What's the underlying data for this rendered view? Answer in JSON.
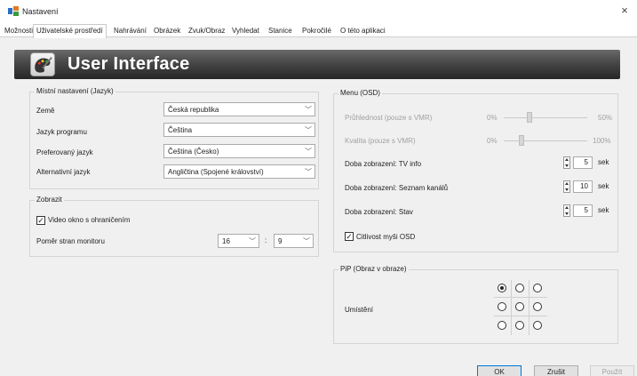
{
  "window": {
    "title": "Nastavení",
    "close": "×"
  },
  "tabs": [
    {
      "label": "Možnosti"
    },
    {
      "label": "Uživatelské prostředí",
      "active": true
    },
    {
      "label": "Nahrávání"
    },
    {
      "label": "Obrázek"
    },
    {
      "label": "Zvuk/Obraz"
    },
    {
      "label": "Vyhledat"
    },
    {
      "label": "Stanice"
    },
    {
      "label": "Pokročilé"
    },
    {
      "label": "O této aplikaci"
    }
  ],
  "banner": {
    "title": "User Interface",
    "icon": "palette-icon"
  },
  "local": {
    "title": "Místní nastavení (Jazyk)",
    "country": {
      "label": "Země",
      "value": "Česká republika"
    },
    "program_language": {
      "label": "Jazyk programu",
      "value": "Čeština"
    },
    "preferred_language": {
      "label": "Preferovaný jazyk",
      "value": "Čeština (Česko)"
    },
    "alt_language": {
      "label": "Alternativní jazyk",
      "value": "Angličtina (Spojené království)"
    }
  },
  "display": {
    "title": "Zobrazit",
    "video_border": {
      "label": "Video okno s ohraničením",
      "checked": true
    },
    "aspect": {
      "label": "Poměr stran monitoru",
      "width": "16",
      "separator": ":",
      "height": "9"
    }
  },
  "menu": {
    "title": "Menu (OSD)",
    "transparency": {
      "label": "Průhlednost (pouze s VMR)",
      "min": "0%",
      "max": "50%",
      "level": 0.4
    },
    "quality": {
      "label": "Kvalita (pouze s VMR)",
      "min": "0%",
      "max": "100%",
      "level": 0.2
    },
    "tv_info": {
      "label": "Doba zobrazení: TV info",
      "value": "5",
      "unit": "sek"
    },
    "channel_list": {
      "label": "Doba zobrazení: Seznam kanálů",
      "value": "10",
      "unit": "sek"
    },
    "status": {
      "label": "Doba zobrazení: Stav",
      "value": "5",
      "unit": "sek"
    },
    "mouse_osd": {
      "label": "Citlivost myši OSD",
      "checked": true
    }
  },
  "pip": {
    "title": "PiP (Obraz v obraze)",
    "position_label": "Umístění",
    "selected_index": 0
  },
  "buttons": {
    "ok": "OK",
    "cancel": "Zrušit",
    "apply": "Použít"
  }
}
